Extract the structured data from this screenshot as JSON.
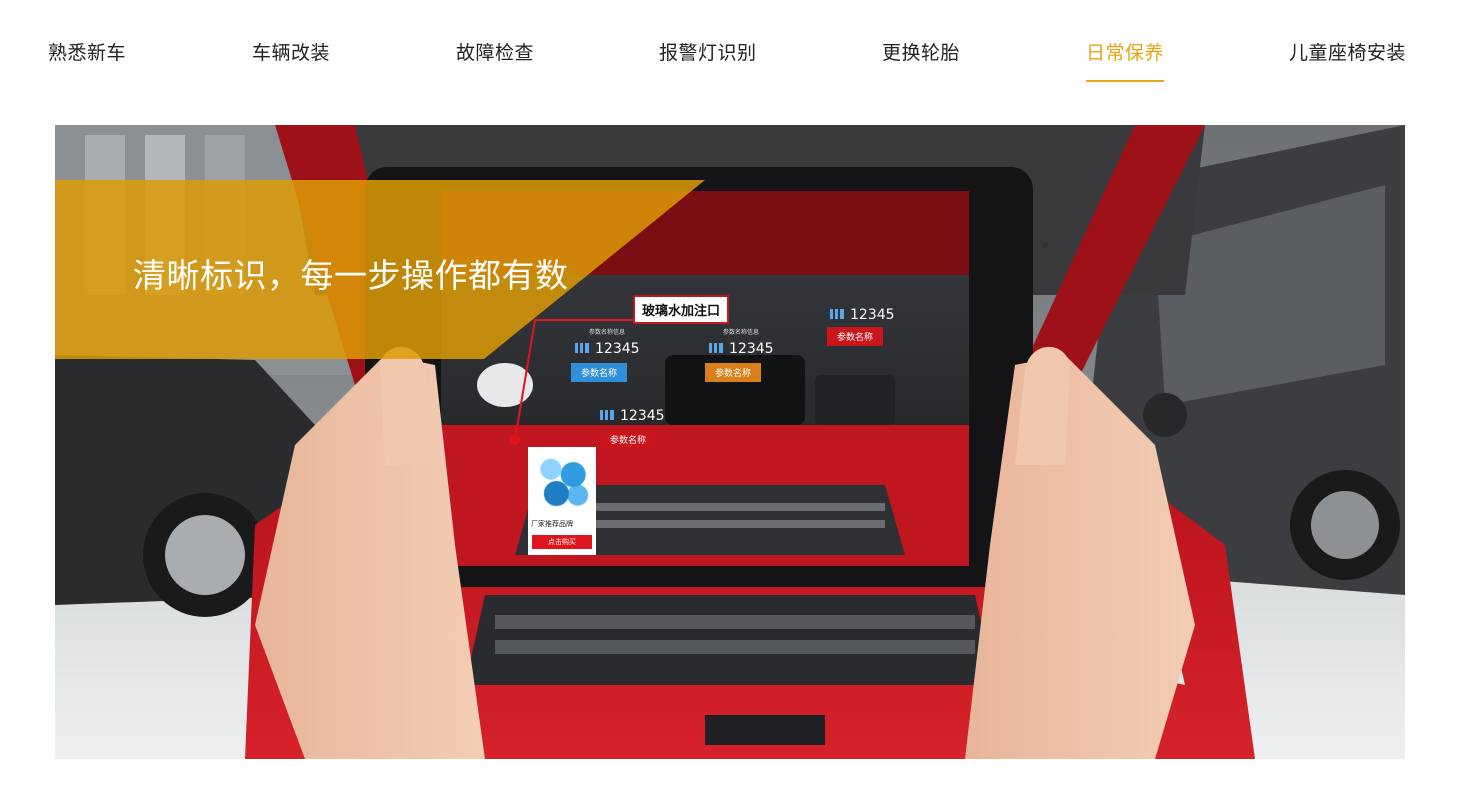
{
  "tabs": [
    {
      "label": "熟悉新车",
      "active": false
    },
    {
      "label": "车辆改装",
      "active": false
    },
    {
      "label": "故障检查",
      "active": false
    },
    {
      "label": "报警灯识别",
      "active": false
    },
    {
      "label": "更换轮胎",
      "active": false
    },
    {
      "label": "日常保养",
      "active": true
    },
    {
      "label": "儿童座椅安装",
      "active": false
    }
  ],
  "colors": {
    "accent": "#e8a413",
    "banner": "#dd9b06",
    "ar_red": "#c9161d",
    "ar_blue": "#2f8fd8",
    "ar_orange": "#d9801a"
  },
  "hero": {
    "headline": "清晰标识，每一步操作都有数",
    "ar": {
      "callout": "玻璃水加注口",
      "stats": [
        {
          "value": "12345",
          "mini": "参数名称信息",
          "tag": "参数名称",
          "tag_color": "#2f8fd8"
        },
        {
          "value": "12345",
          "mini": "参数名称信息",
          "tag": "参数名称",
          "tag_color": "#d9801a"
        },
        {
          "value": "12345",
          "mini": "",
          "tag": "参数名称",
          "tag_color": "#c9161d"
        },
        {
          "value": "12345",
          "mini": "",
          "tag": "参数名称",
          "tag_color": "#c9161d"
        }
      ],
      "product": {
        "brand": "厂家推荐品牌",
        "buy": "点击购买"
      }
    }
  }
}
